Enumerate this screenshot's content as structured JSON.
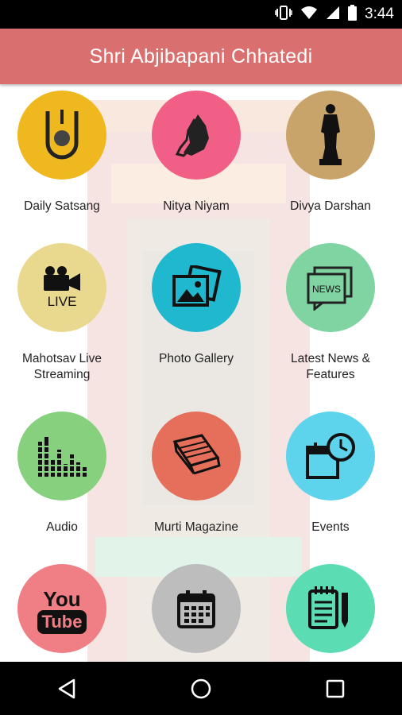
{
  "status_bar": {
    "time": "3:44",
    "icons": [
      "vibrate-icon",
      "wifi-icon",
      "signal-icon",
      "battery-icon"
    ]
  },
  "app_bar": {
    "title": "Shri Abjibapani Chhatedi",
    "color": "#d9706f"
  },
  "tiles": [
    {
      "label": "Daily Satsang",
      "icon": "satsang-icon",
      "color": "#f0b81f"
    },
    {
      "label": "Nitya Niyam",
      "icon": "praying-hands-icon",
      "color": "#f25f86"
    },
    {
      "label": "Divya Darshan",
      "icon": "statue-icon",
      "color": "#c9a46a"
    },
    {
      "label": "Mahotsav Live Streaming",
      "icon": "live-video-icon",
      "color": "#e8d98f",
      "icon_text": "LIVE"
    },
    {
      "label": "Photo Gallery",
      "icon": "photo-gallery-icon",
      "color": "#1fb8cf"
    },
    {
      "label": "Latest News & Features",
      "icon": "news-icon",
      "color": "#7fd4a2",
      "icon_text": "NEWS"
    },
    {
      "label": "Audio",
      "icon": "audio-equalizer-icon",
      "color": "#86d07e"
    },
    {
      "label": "Murti Magazine",
      "icon": "magazine-icon",
      "color": "#e56f5a"
    },
    {
      "label": "Events",
      "icon": "events-calendar-clock-icon",
      "color": "#5ed3ec"
    },
    {
      "label": "",
      "icon": "youtube-icon",
      "color": "#f07e85",
      "icon_text_1": "You",
      "icon_text_2": "Tube"
    },
    {
      "label": "",
      "icon": "calendar-icon",
      "color": "#bdbdbd"
    },
    {
      "label": "",
      "icon": "notepad-icon",
      "color": "#5bdcb3"
    }
  ],
  "nav": [
    "back-icon",
    "home-icon",
    "recents-icon"
  ]
}
